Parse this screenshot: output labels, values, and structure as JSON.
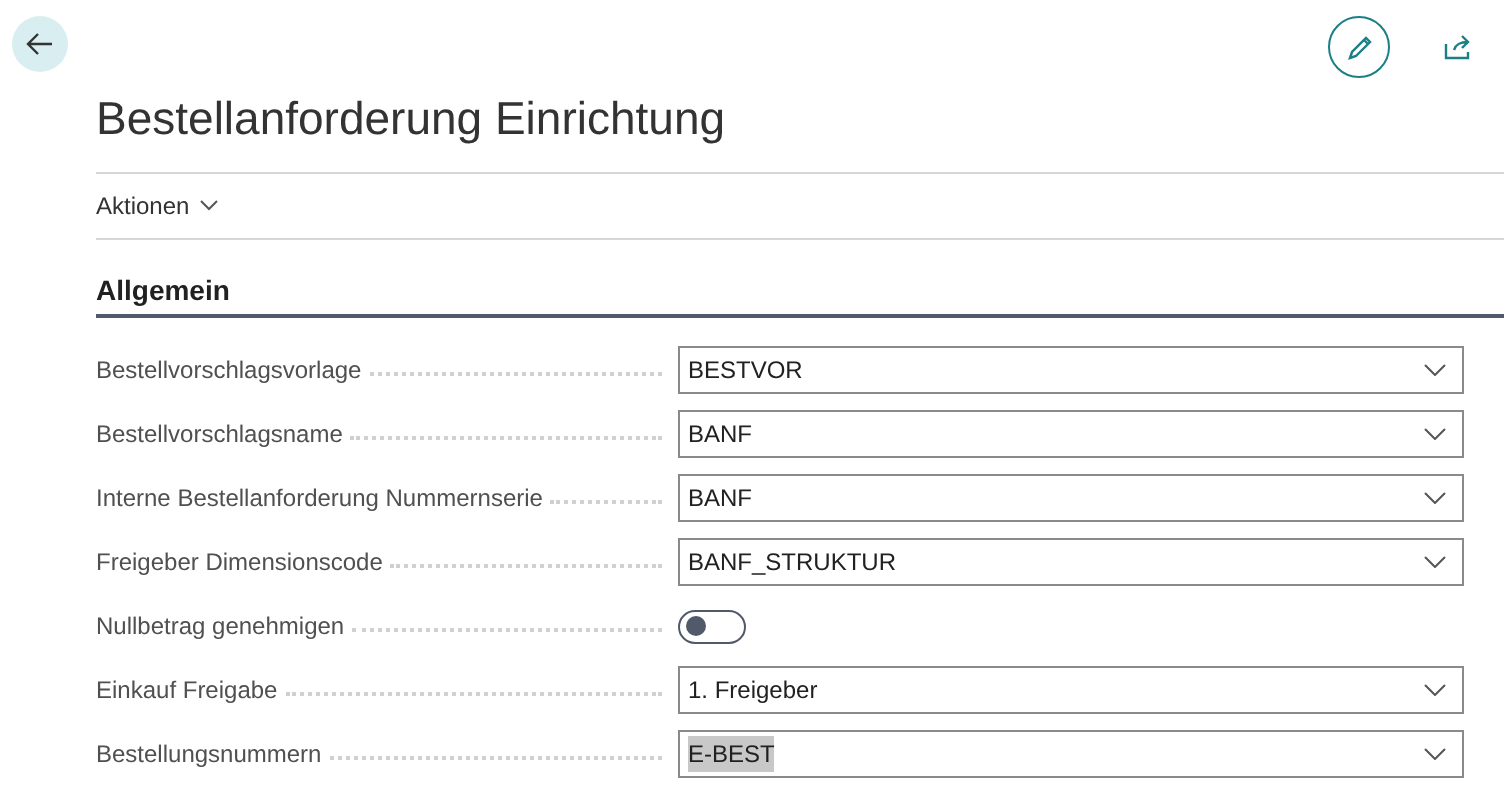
{
  "page": {
    "title": "Bestellanforderung Einrichtung"
  },
  "actions_menu": {
    "label": "Aktionen"
  },
  "section": {
    "title": "Allgemein"
  },
  "fields": [
    {
      "kind": "dropdown",
      "label": "Bestellvorschlagsvorlage",
      "value": "BESTVOR",
      "text_selected": false
    },
    {
      "kind": "dropdown",
      "label": "Bestellvorschlagsname",
      "value": "BANF",
      "text_selected": false
    },
    {
      "kind": "dropdown",
      "label": "Interne Bestellanforderung Nummernserie",
      "value": "BANF",
      "text_selected": false
    },
    {
      "kind": "dropdown",
      "label": "Freigeber Dimensionscode",
      "value": "BANF_STRUKTUR",
      "text_selected": false
    },
    {
      "kind": "toggle",
      "label": "Nullbetrag genehmigen",
      "on": false
    },
    {
      "kind": "dropdown",
      "label": "Einkauf Freigabe",
      "value": "1. Freigeber",
      "text_selected": false
    },
    {
      "kind": "dropdown",
      "label": "Bestellungsnummern",
      "value": "E-BEST",
      "text_selected": true
    }
  ]
}
